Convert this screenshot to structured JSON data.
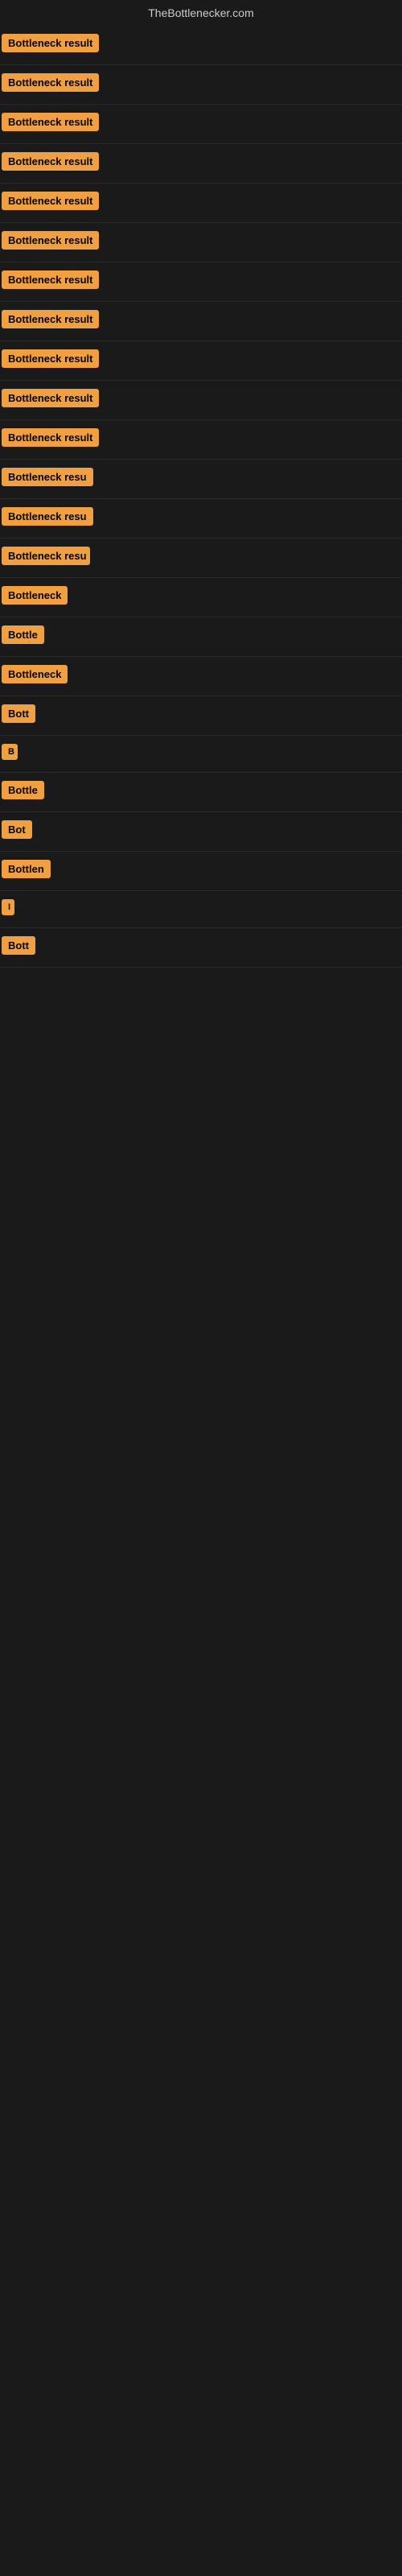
{
  "site": {
    "title": "TheBottlenecker.com"
  },
  "results": [
    {
      "id": 1,
      "label": "Bottleneck result",
      "width": 155
    },
    {
      "id": 2,
      "label": "Bottleneck result",
      "width": 155
    },
    {
      "id": 3,
      "label": "Bottleneck result",
      "width": 155
    },
    {
      "id": 4,
      "label": "Bottleneck result",
      "width": 155
    },
    {
      "id": 5,
      "label": "Bottleneck result",
      "width": 155
    },
    {
      "id": 6,
      "label": "Bottleneck result",
      "width": 155
    },
    {
      "id": 7,
      "label": "Bottleneck result",
      "width": 155
    },
    {
      "id": 8,
      "label": "Bottleneck result",
      "width": 155
    },
    {
      "id": 9,
      "label": "Bottleneck result",
      "width": 155
    },
    {
      "id": 10,
      "label": "Bottleneck result",
      "width": 155
    },
    {
      "id": 11,
      "label": "Bottleneck result",
      "width": 148
    },
    {
      "id": 12,
      "label": "Bottleneck resu",
      "width": 130
    },
    {
      "id": 13,
      "label": "Bottleneck resu",
      "width": 120
    },
    {
      "id": 14,
      "label": "Bottleneck resu",
      "width": 110
    },
    {
      "id": 15,
      "label": "Bottleneck",
      "width": 90
    },
    {
      "id": 16,
      "label": "Bottle",
      "width": 62
    },
    {
      "id": 17,
      "label": "Bottleneck",
      "width": 85
    },
    {
      "id": 18,
      "label": "Bott",
      "width": 48
    },
    {
      "id": 19,
      "label": "B",
      "width": 20
    },
    {
      "id": 20,
      "label": "Bottle",
      "width": 58
    },
    {
      "id": 21,
      "label": "Bot",
      "width": 40
    },
    {
      "id": 22,
      "label": "Bottlen",
      "width": 72
    },
    {
      "id": 23,
      "label": "I",
      "width": 14
    },
    {
      "id": 24,
      "label": "Bott",
      "width": 50
    }
  ],
  "colors": {
    "badge_bg": "#f0a040",
    "badge_text": "#000000",
    "background": "#1a1a1a",
    "title_text": "#cccccc"
  }
}
